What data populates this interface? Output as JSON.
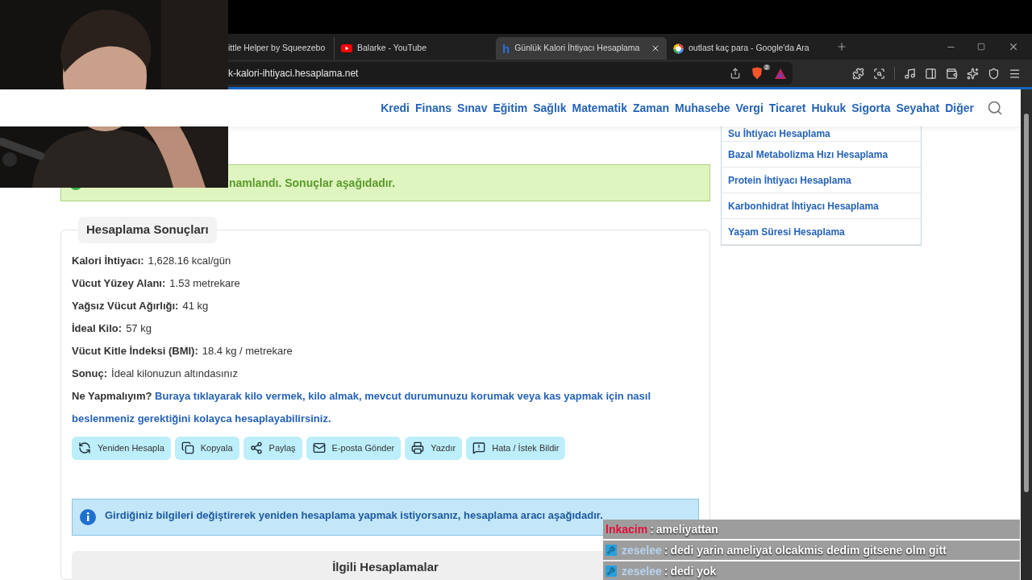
{
  "browser": {
    "tabs": [
      {
        "title": "ittle Helper by Squeezebo",
        "selected": false,
        "kind": "plain"
      },
      {
        "title": "Balarke - YouTube",
        "selected": false,
        "kind": "video"
      },
      {
        "title": "Günlük Kalori İhtiyacı Hesaplama",
        "selected": true,
        "kind": "site",
        "favicon_text": "h"
      },
      {
        "title": "outlast kaç para - Google'da Ara",
        "selected": false,
        "kind": "search"
      }
    ],
    "address": "k-kalori-ihtiyaci.hesaplama.net",
    "shield_badge": "2"
  },
  "nav": [
    "Kredi",
    "Finans",
    "Sınav",
    "Eğitim",
    "Sağlık",
    "Matematik",
    "Zaman",
    "Muhasebe",
    "Vergi",
    "Ticaret",
    "Hukuk",
    "Sigorta",
    "Seyahat",
    "Diğer"
  ],
  "alert": {
    "text": "namlandı. Sonuçlar aşağıdadır."
  },
  "results": {
    "title": "Hesaplama Sonuçları",
    "rows": [
      {
        "label": "Kalori İhtiyacı:",
        "value": "1,628.16 kcal/gün"
      },
      {
        "label": "Vücut Yüzey Alanı:",
        "value": "1.53 metrekare"
      },
      {
        "label": "Yağsız Vücut Ağırlığı:",
        "value": "41 kg"
      },
      {
        "label": "İdeal Kilo:",
        "value": "57 kg"
      },
      {
        "label": "Vücut Kitle İndeksi (BMI):",
        "value": "18.4 kg / metrekare"
      },
      {
        "label": "Sonuç:",
        "value": "İdeal kilonuzun altındasınız"
      }
    ],
    "advice": {
      "label": "Ne Yapmalıyım?",
      "link": "Buraya tıklayarak kilo vermek, kilo almak, mevcut durumunuzu korumak veya kas yapmak için nasıl beslenmeniz gerektiğini kolayca hesaplayabilirsiniz."
    }
  },
  "actions": [
    {
      "label": "Yeniden Hesapla",
      "kind": "recalc"
    },
    {
      "label": "Kopyala",
      "kind": "copy"
    },
    {
      "label": "Paylaş",
      "kind": "share"
    },
    {
      "label": "E-posta Gönder",
      "kind": "mail"
    },
    {
      "label": "Yazdır",
      "kind": "print"
    },
    {
      "label": "Hata / İstek Bildir",
      "kind": "report"
    }
  ],
  "info": {
    "text": "Girdiğiniz bilgileri değiştirerek yeniden hesaplama yapmak istiyorsanız, hesaplama aracı aşağıdadır."
  },
  "related": {
    "title": "İlgili Hesaplamalar"
  },
  "sidebar_links": [
    "Su İhtiyacı Hesaplama",
    "Bazal Metabolizma Hızı Hesaplama",
    "Protein İhtiyacı Hesaplama",
    "Karbonhidrat İhtiyacı Hesaplama",
    "Yaşam Süresi Hesaplama"
  ],
  "chat": [
    {
      "user": "lnkacim",
      "separator": ":",
      "message": "ameliyattan",
      "badge": false
    },
    {
      "user": "zeselee",
      "separator": ":",
      "message": "dedi yarin ameliyat olcakmis dedim gitsene olm gitt",
      "badge": true
    },
    {
      "user": "zeselee",
      "separator": ":",
      "message": "dedi yok",
      "badge": true
    }
  ]
}
